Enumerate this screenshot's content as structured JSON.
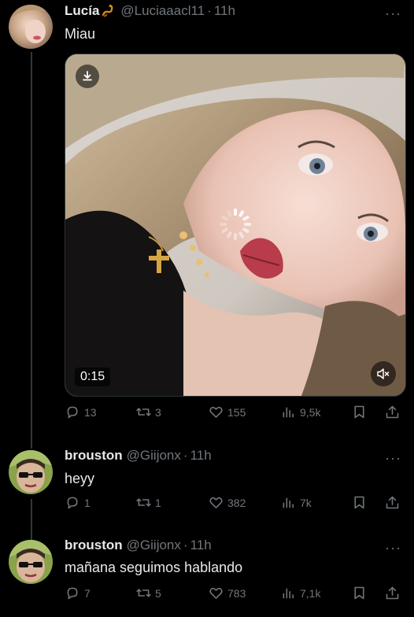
{
  "tweets": [
    {
      "name": "Lucía",
      "handle": "@Luciaaacl11",
      "separator": "·",
      "time": "11h",
      "text": "Miau",
      "video_duration": "0:15",
      "replies": "13",
      "retweets": "3",
      "likes": "155",
      "views": "9,5k"
    },
    {
      "name": "brouston",
      "handle": "@Giijonx",
      "separator": "·",
      "time": "11h",
      "text": "heyy",
      "replies": "1",
      "retweets": "1",
      "likes": "382",
      "views": "7k"
    },
    {
      "name": "brouston",
      "handle": "@Giijonx",
      "separator": "·",
      "time": "11h",
      "text": "mañana seguimos hablando",
      "replies": "7",
      "retweets": "5",
      "likes": "783",
      "views": "7,1k"
    }
  ],
  "more_label": "···",
  "icons": {
    "reply": "reply-icon",
    "retweet": "retweet-icon",
    "like": "heart-icon",
    "views": "views-icon",
    "bookmark": "bookmark-icon",
    "share": "share-icon",
    "download": "download-icon",
    "mute": "mute-icon",
    "loading": "loading-spinner-icon"
  },
  "colors": {
    "background": "#000000",
    "text": "#e7e9ea",
    "muted": "#71767b",
    "thread_line": "#333639"
  }
}
